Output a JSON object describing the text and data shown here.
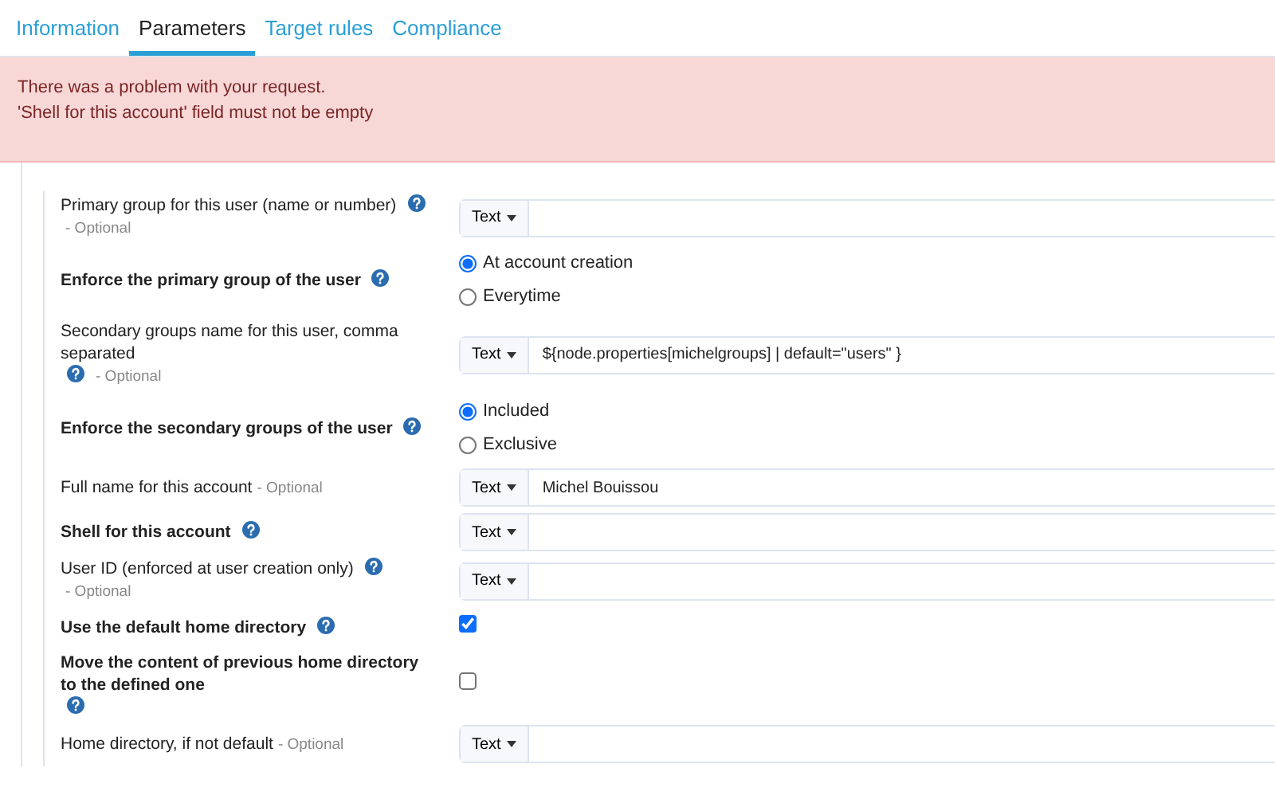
{
  "tabs": [
    {
      "label": "Information",
      "selected": false
    },
    {
      "label": "Parameters",
      "selected": true
    },
    {
      "label": "Target rules",
      "selected": false
    },
    {
      "label": "Compliance",
      "selected": false
    }
  ],
  "alert": {
    "lines": [
      "There was a problem with your request.",
      "'Shell for this account' field must not be empty"
    ]
  },
  "fields": [
    {
      "kind": "text",
      "label": "Primary group for this user (name or number)",
      "required": false,
      "help": true,
      "optional": "- Optional",
      "type": "Text"
    },
    {
      "kind": "radio",
      "label": "Enforce the primary group of the user",
      "required": true,
      "help": true,
      "options": [
        {
          "label": "At account creation",
          "selected": true
        },
        {
          "label": "Everytime",
          "selected": false
        }
      ]
    },
    {
      "kind": "text",
      "label": "Secondary groups name for this user, comma separated",
      "required": false,
      "help": true,
      "optional": "- Optional",
      "type": "Text",
      "value": "${node.properties[michelgroups] | default=\"users\" }"
    },
    {
      "kind": "radio",
      "label": "Enforce the secondary groups of the user",
      "required": true,
      "help": true,
      "options": [
        {
          "label": "Included",
          "selected": true
        },
        {
          "label": "Exclusive",
          "selected": false
        }
      ]
    },
    {
      "kind": "text",
      "label": "Full name for this account",
      "required": false,
      "help": false,
      "optional": "- Optional",
      "type": "Text",
      "value": "Michel Bouissou"
    },
    {
      "kind": "text",
      "label": "Shell for this account",
      "required": true,
      "help": true,
      "type": "Text"
    },
    {
      "kind": "text",
      "label": "User ID (enforced at user creation only)",
      "required": false,
      "help": true,
      "optional": "- Optional",
      "type": "Text"
    },
    {
      "kind": "checkbox",
      "label": "Use the default home directory",
      "required": true,
      "help": true,
      "checked": true
    },
    {
      "kind": "checkbox",
      "label": "Move the content of previous home directory to the defined one",
      "required": true,
      "help": true,
      "checked": false
    },
    {
      "kind": "text",
      "label": "Home directory, if not default",
      "required": false,
      "help": false,
      "optional": "- Optional",
      "type": "Text"
    }
  ]
}
